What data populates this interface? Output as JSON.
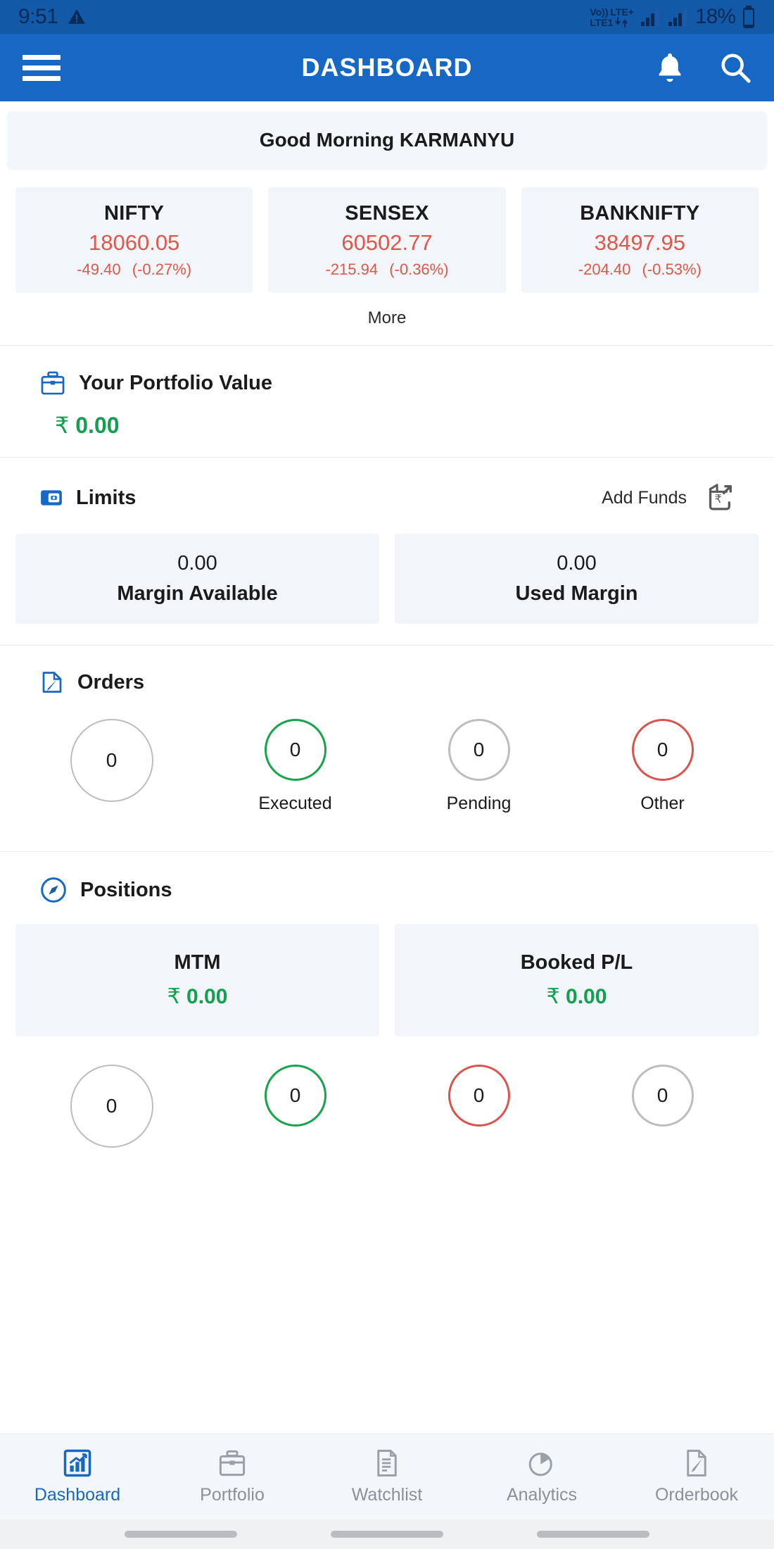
{
  "status_bar": {
    "time": "9:51",
    "warning_icon": "warning-triangle-icon",
    "volte": "Vo))",
    "lte_plus": "LTE+",
    "lte1": "LTE1",
    "battery_percent": "18%"
  },
  "app_bar": {
    "menu_icon": "hamburger-menu-icon",
    "title": "DASHBOARD",
    "notification_icon": "bell-icon",
    "search_icon": "search-icon",
    "background_color": "#1668c4"
  },
  "greeting": {
    "text": "Good Morning KARMANYU"
  },
  "indices": {
    "items": [
      {
        "name": "NIFTY",
        "value": "18060.05",
        "change": "-49.40",
        "change_pct": "(-0.27%)"
      },
      {
        "name": "SENSEX",
        "value": "60502.77",
        "change": "-215.94",
        "change_pct": "(-0.36%)"
      },
      {
        "name": "BANKNIFTY",
        "value": "38497.95",
        "change": "-204.40",
        "change_pct": "(-0.53%)"
      }
    ],
    "more_label": "More",
    "negative_color": "#e0574a"
  },
  "portfolio": {
    "icon": "briefcase-icon",
    "title": "Your Portfolio Value",
    "currency": "₹",
    "value": "0.00",
    "value_color": "#12a050"
  },
  "limits": {
    "icon": "card-icon",
    "title": "Limits",
    "add_funds_label": "Add Funds",
    "add_funds_icon": "wallet-rupee-export-icon",
    "cards": [
      {
        "value": "0.00",
        "label": "Margin Available"
      },
      {
        "value": "0.00",
        "label": "Used Margin"
      }
    ]
  },
  "orders": {
    "icon": "edit-document-icon",
    "title": "Orders",
    "circles": [
      {
        "count": "0",
        "label": "",
        "color": "#bdbdbd",
        "size": "big"
      },
      {
        "count": "0",
        "label": "Executed",
        "color": "#16a34a",
        "size": "sm"
      },
      {
        "count": "0",
        "label": "Pending",
        "color": "#bdbdbd",
        "size": "sm"
      },
      {
        "count": "0",
        "label": "Other",
        "color": "#d9534f",
        "size": "sm"
      }
    ]
  },
  "positions": {
    "icon": "compass-icon",
    "title": "Positions",
    "cards": [
      {
        "label": "MTM",
        "currency": "₹",
        "value": "0.00"
      },
      {
        "label": "Booked P/L",
        "currency": "₹",
        "value": "0.00"
      }
    ],
    "circles": [
      {
        "count": "0",
        "color": "#bdbdbd",
        "size": "big"
      },
      {
        "count": "0",
        "color": "#16a34a",
        "size": "sm"
      },
      {
        "count": "0",
        "color": "#d9534f",
        "size": "sm"
      },
      {
        "count": "0",
        "color": "#bdbdbd",
        "size": "sm"
      }
    ]
  },
  "bottom_nav": {
    "active": "Dashboard",
    "items": [
      {
        "label": "Dashboard",
        "icon": "chart-growth-icon"
      },
      {
        "label": "Portfolio",
        "icon": "briefcase-icon"
      },
      {
        "label": "Watchlist",
        "icon": "list-document-icon"
      },
      {
        "label": "Analytics",
        "icon": "pie-chart-icon"
      },
      {
        "label": "Orderbook",
        "icon": "edit-document-icon"
      }
    ]
  }
}
